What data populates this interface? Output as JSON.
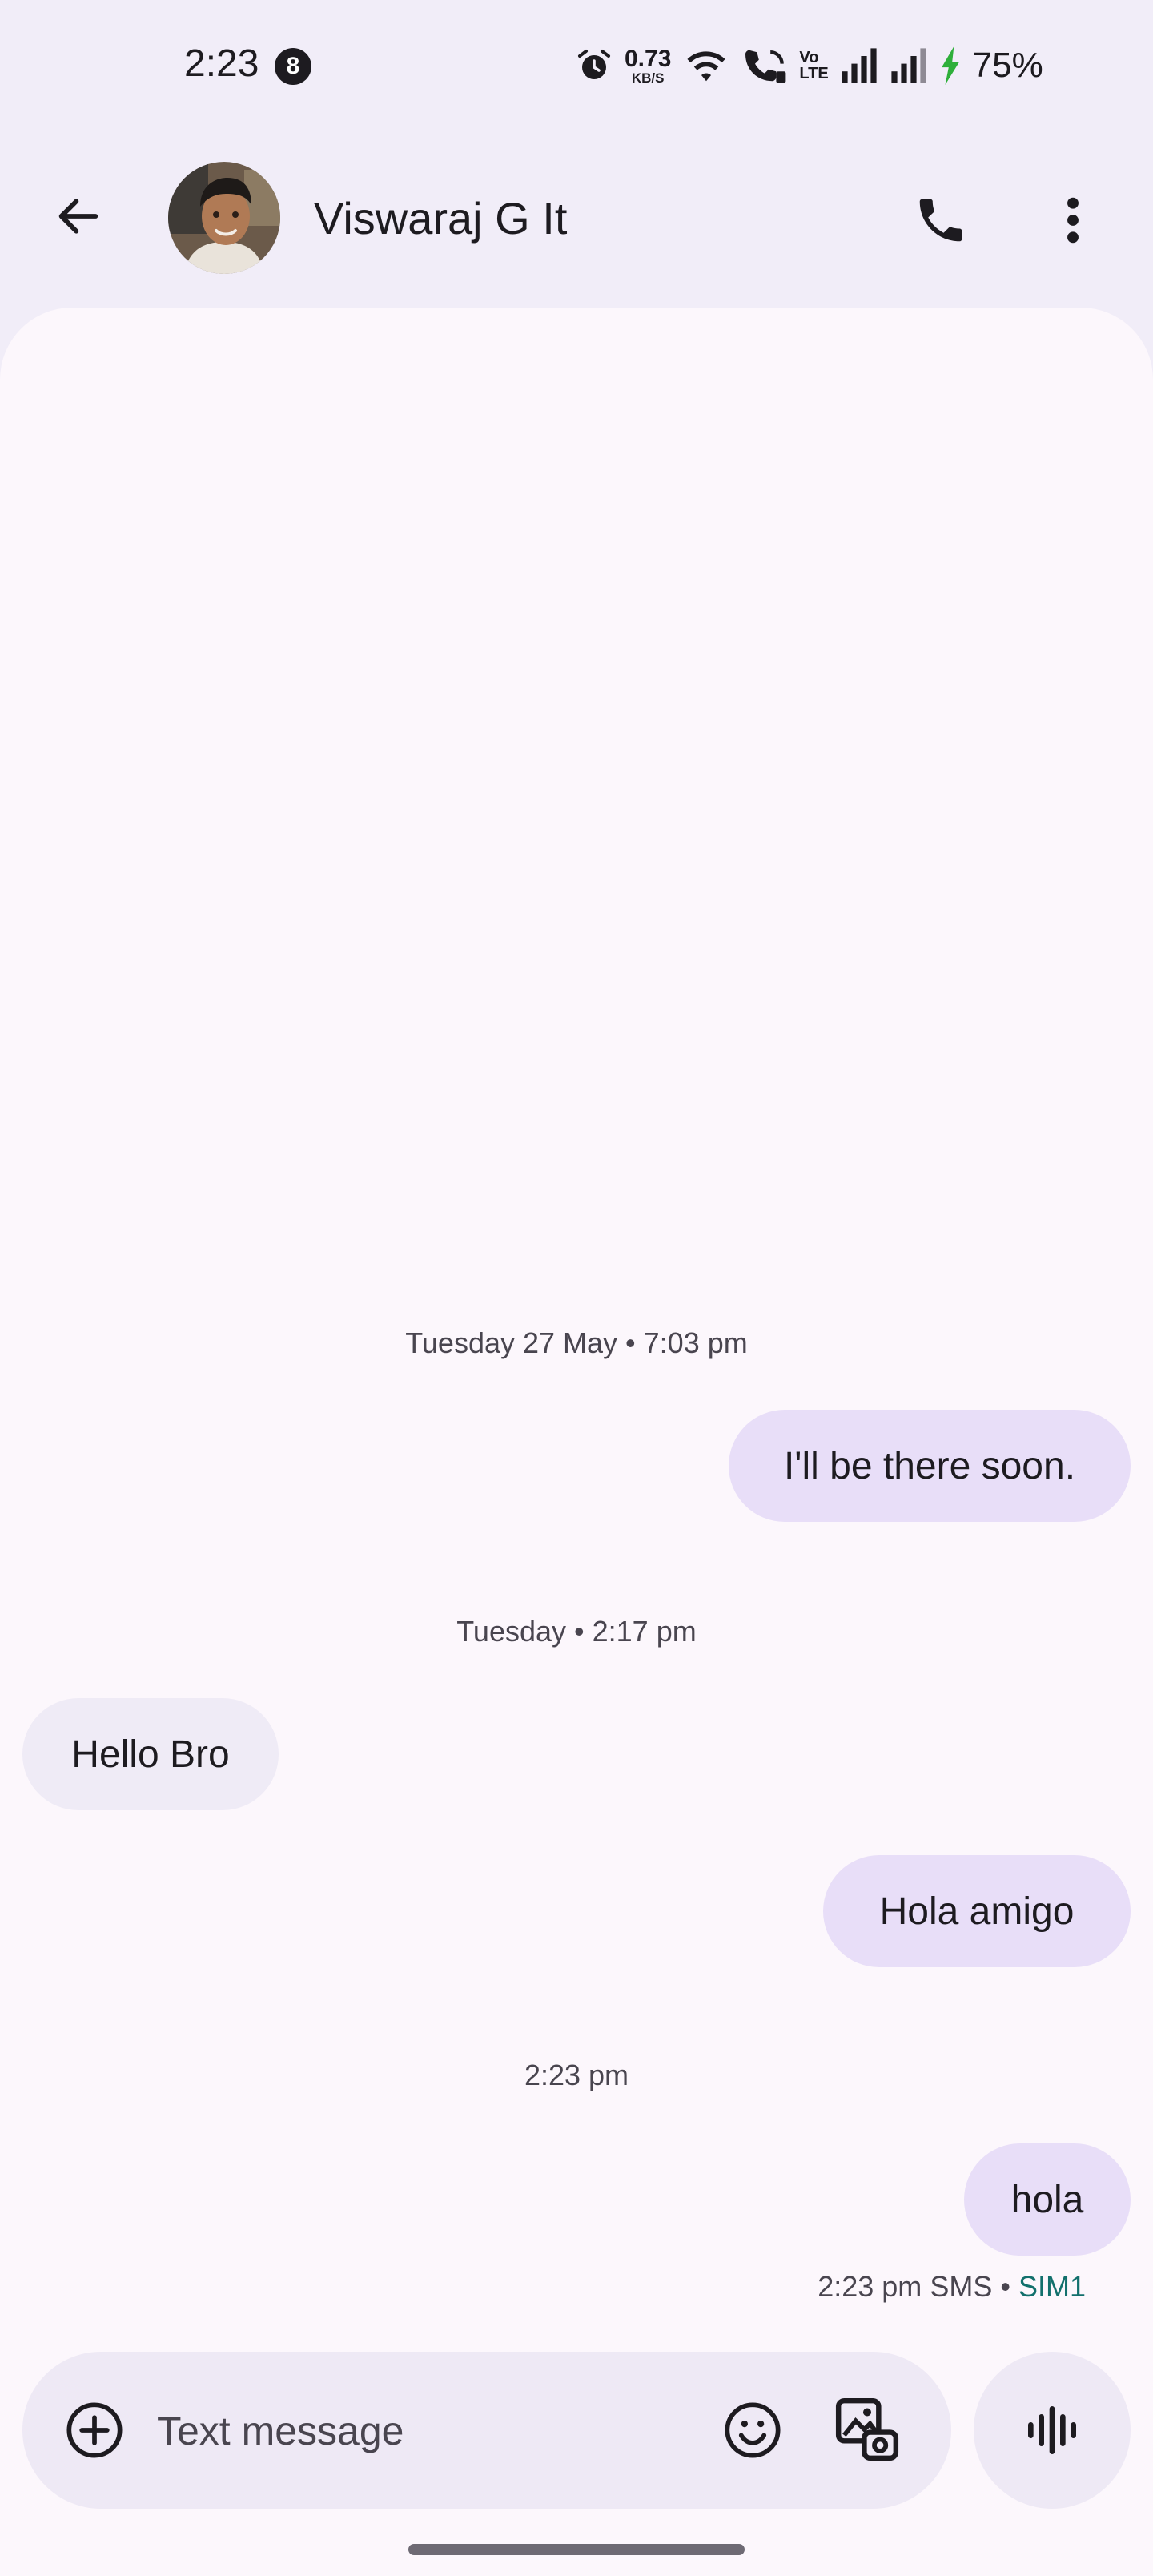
{
  "status_bar": {
    "time": "2:23",
    "notification_count": "8",
    "data_rate_value": "0.73",
    "data_rate_unit": "KB/S",
    "volte_top": "Vo",
    "volte_bottom": "LTE",
    "battery": "75%",
    "icons": [
      "alarm-icon",
      "wifi-icon",
      "wifi-calling-icon",
      "signal-icon",
      "signal-icon",
      "charging-icon"
    ]
  },
  "header": {
    "contact_name": "Viswaraj G It",
    "icons": [
      "back-arrow-icon",
      "phone-icon",
      "more-vert-icon"
    ]
  },
  "messages": [
    {
      "type": "timestamp",
      "text": "Tuesday 27 May • 7:03 pm"
    },
    {
      "type": "outgoing",
      "text": "I'll be there soon."
    },
    {
      "type": "timestamp",
      "text": "Tuesday • 2:17 pm"
    },
    {
      "type": "incoming",
      "text": "Hello Bro"
    },
    {
      "type": "outgoing",
      "text": "Hola amigo"
    },
    {
      "type": "timestamp",
      "text": "2:23 pm"
    },
    {
      "type": "outgoing",
      "text": "hola"
    }
  ],
  "last_message_meta": {
    "time": "2:23 pm",
    "transport": "SMS",
    "separator": "•",
    "sim": "SIM1"
  },
  "composer": {
    "placeholder": "Text message",
    "icons": [
      "add-circle-icon",
      "emoji-icon",
      "gallery-icon",
      "voice-wave-icon"
    ]
  },
  "colors": {
    "background": "#F1EDF8",
    "conversation_bg": "#FCF7FC",
    "outgoing_bubble": "#E8DEF8",
    "incoming_bubble": "#EFEBF6",
    "sim_label": "#12706C",
    "charging": "#2EAF3A"
  }
}
